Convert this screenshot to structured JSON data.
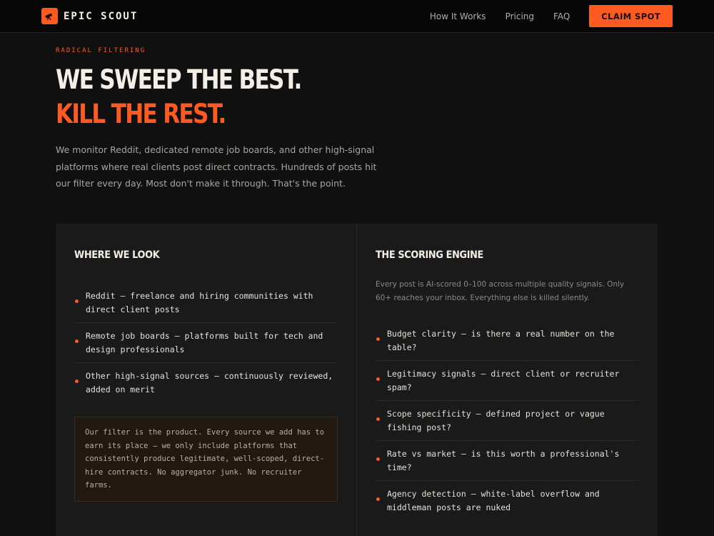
{
  "nav": {
    "brand": "EPIC SCOUT",
    "logo_icon": "telescope-icon",
    "links": [
      "How It Works",
      "Pricing",
      "FAQ"
    ],
    "cta": "CLAIM SPOT"
  },
  "hero": {
    "eyebrow": "RADICAL FILTERING",
    "headline_line1": "WE SWEEP THE BEST.",
    "headline_line2": "KILL THE REST.",
    "lead": "We monitor Reddit, dedicated remote job boards, and other high-signal platforms where real clients post direct contracts. Hundreds of posts hit our filter every day. Most don't make it through. That's the point."
  },
  "where_we_look": {
    "title": "WHERE WE LOOK",
    "items": [
      "Reddit — freelance and hiring communities with direct client posts",
      "Remote job boards — platforms built for tech and design professionals",
      "Other high-signal sources — continuously reviewed, added on merit"
    ],
    "note": "Our filter is the product. Every source we add has to earn its place — we only include platforms that consistently produce legitimate, well-scoped, direct-hire contracts. No aggregator junk. No recruiter farms."
  },
  "scoring_engine": {
    "title": "THE SCORING ENGINE",
    "description": "Every post is AI-scored 0–100 across multiple quality signals. Only 60+ reaches your inbox. Everything else is killed silently.",
    "items": [
      "Budget clarity — is there a real number on the table?",
      "Legitimacy signals — direct client or recruiter spam?",
      "Scope specificity — defined project or vague fishing post?",
      "Rate vs market — is this worth a professional's time?",
      "Agency detection — white-label overflow and middleman posts are nuked"
    ]
  },
  "colors": {
    "accent": "#ff5a1f",
    "background": "#101010",
    "panel": "#1a1a1a"
  }
}
